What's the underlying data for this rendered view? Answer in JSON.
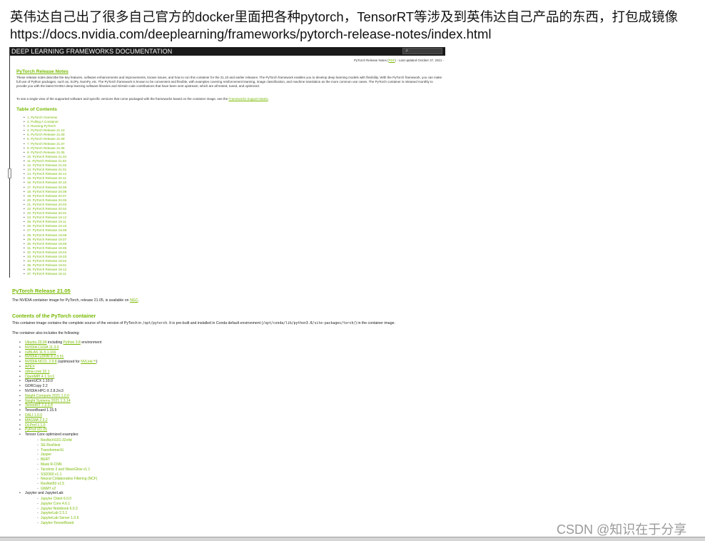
{
  "caption": {
    "line1": "英伟达自己出了很多自己官方的docker里面把各种pytorch，TensorRT等涉及到英伟达自己产品的东西，打包成镜像",
    "line2": "https://docs.nvidia.com/deeplearning/frameworks/pytorch-release-notes/index.html"
  },
  "doc": {
    "header_title": "DEEP LEARNING FRAMEWORKS DOCUMENTATION",
    "updated_prefix": "PyTorch Release Notes (",
    "updated_pdf": "PDF",
    "updated_suffix": ") - Last updated October 27, 2021 -",
    "release_notes_title": "PyTorch Release Notes",
    "intro": "These release notes describe the key features, software enhancements and improvements, known issues, and how to run this container for the 21.10 and earlier releases. The PyTorch framework enables you to develop deep learning models with flexibility. With the PyTorch framework, you can make full use of Python packages, such as, SciPy, NumPy, etc. The PyTorch framework is known to be convenient and flexible, with examples covering reinforcement learning, image classification, and machine translation as the more common use cases. The PyTorch container is released monthly to provide you with the latest NVIDIA deep learning software libraries and GitHub code contributions that have been sent upstream; which are all tested, tuned, and optimized.",
    "matrix_prefix": "To see a single view of the supported software and specific versions that come packaged with the frameworks based on the container image, see the ",
    "matrix_link": "Frameworks Support Matrix",
    "matrix_suffix": ".",
    "toc_title": "Table of Contents",
    "toc": [
      "1. PyTorch Overview",
      "2. Pulling A Container",
      "3. Running PyTorch",
      "4. PyTorch Release 21.10",
      "5. PyTorch Release 21.09",
      "6. PyTorch Release 21.08",
      "7. PyTorch Release 21.07",
      "8. PyTorch Release 21.06",
      "9. PyTorch Release 21.05",
      "10. PyTorch Release 21.04",
      "11. PyTorch Release 21.03",
      "12. PyTorch Release 21.02",
      "13. PyTorch Release 21.01",
      "14. PyTorch Release 20.12",
      "15. PyTorch Release 20.11",
      "16. PyTorch Release 20.10",
      "17. PyTorch Release 20.09",
      "18. PyTorch Release 20.08",
      "19. PyTorch Release 20.07",
      "20. PyTorch Release 20.06",
      "21. PyTorch Release 20.03",
      "22. PyTorch Release 20.02",
      "23. PyTorch Release 20.01",
      "24. PyTorch Release 19.12",
      "25. PyTorch Release 19.11",
      "26. PyTorch Release 19.10",
      "27. PyTorch Release 19.09",
      "28. PyTorch Release 19.08",
      "29. PyTorch Release 19.07",
      "30. PyTorch Release 19.06",
      "31. PyTorch Release 19.05",
      "32. PyTorch Release 19.04",
      "33. PyTorch Release 19.03",
      "34. PyTorch Release 19.02",
      "35. PyTorch Release 19.01",
      "36. PyTorch Release 18.12",
      "37. PyTorch Release 18.11"
    ]
  },
  "release": {
    "title": "PyTorch Release 21.05",
    "avail_prefix": "The NVIDIA container image for PyTorch, release 21.05, is available on ",
    "avail_link": "NGC",
    "avail_suffix": ".",
    "contents_title": "Contents of the PyTorch container",
    "contents_prefix": "This container image contains the complete source of the version of PyTorch in ",
    "contents_path1": "/opt/pytorch",
    "contents_mid": ". It is pre-built and installed in Conda default environment (",
    "contents_path2": "/opt/conda/lib/python3.8/site-packages/torch/",
    "contents_suffix": ") in the container image.",
    "also_includes": "The container also includes the following:",
    "ubuntu_link": "Ubuntu 20.04",
    "ubuntu_mid": " including ",
    "python_link": "Python 3.8",
    "ubuntu_suffix": " environment",
    "nccl_link": "NVIDIA NCCL 2.9.8",
    "nccl_mid": " (optimized for ",
    "nvlink_link": "NVLink™",
    "nccl_suffix": ")",
    "components": [
      {
        "text": "NVIDIA CUDA 11.3.0",
        "link": true
      },
      {
        "text": "cuBLAS 11.5.1.101",
        "link": true
      },
      {
        "text": "NVIDIA cuDNN 8.2.0.51",
        "link": true
      },
      {
        "text": "APEX",
        "link": true
      },
      {
        "text": "rdma-core 32.1",
        "link": true
      },
      {
        "text": "OpenMPI 4.1.1rc1",
        "link": true
      },
      {
        "text": "OpenUCX 1.10.0",
        "link": false
      },
      {
        "text": "GDRCopy 2.2",
        "link": false
      },
      {
        "text": "NVIDIA HPC-X 2.8.2rc3",
        "link": false
      },
      {
        "text": "Nsight Compute 2021.1.0.0",
        "link": true
      },
      {
        "text": "Nsight Systems 2021.1.3.14",
        "link": true
      },
      {
        "text": "TensorRT 7.2.3.4",
        "link": true
      },
      {
        "text": "TensorBoard 1.15.5",
        "link": false
      },
      {
        "text": "DALI 1.0.0",
        "link": true
      },
      {
        "text": "MAGMA 2.5.2",
        "link": true
      },
      {
        "text": "DLProf 1.1.0",
        "link": true
      },
      {
        "text": "PyProf r21.05",
        "link": true
      }
    ],
    "tensorcore_label": "Tensor Core optimized examples:",
    "tensorcore_examples": [
      "ResNeXt101-32x4d",
      "SE-ResNext",
      "TransformerXL",
      "Jasper",
      "BERT",
      "Mask R-CNN",
      "Tacotron 2 and WaveGlow v1.1",
      "SSD300 v1.1",
      "Neural Collaborative Filtering (NCF)",
      "ResNet50 v1.5",
      "GNMT v2"
    ],
    "jupyter_label": "Jupyter and JupyterLab:",
    "jupyter_items": [
      "Jupyter Client 6.0.0",
      "Jupyter Core 4.6.1",
      "Jupyter Notebook 6.0.3",
      "JupyterLab 2.3.1",
      "JupyterLab Server 1.0.6",
      "Jupyter-TensorBoard"
    ]
  },
  "watermark": "CSDN @知识在于分享",
  "colors": {
    "accent": "#76b900",
    "header_bg": "#1a1a1a"
  },
  "icons": {
    "search": "search-icon",
    "sidebar_toggle": "sidebar-toggle-icon"
  }
}
